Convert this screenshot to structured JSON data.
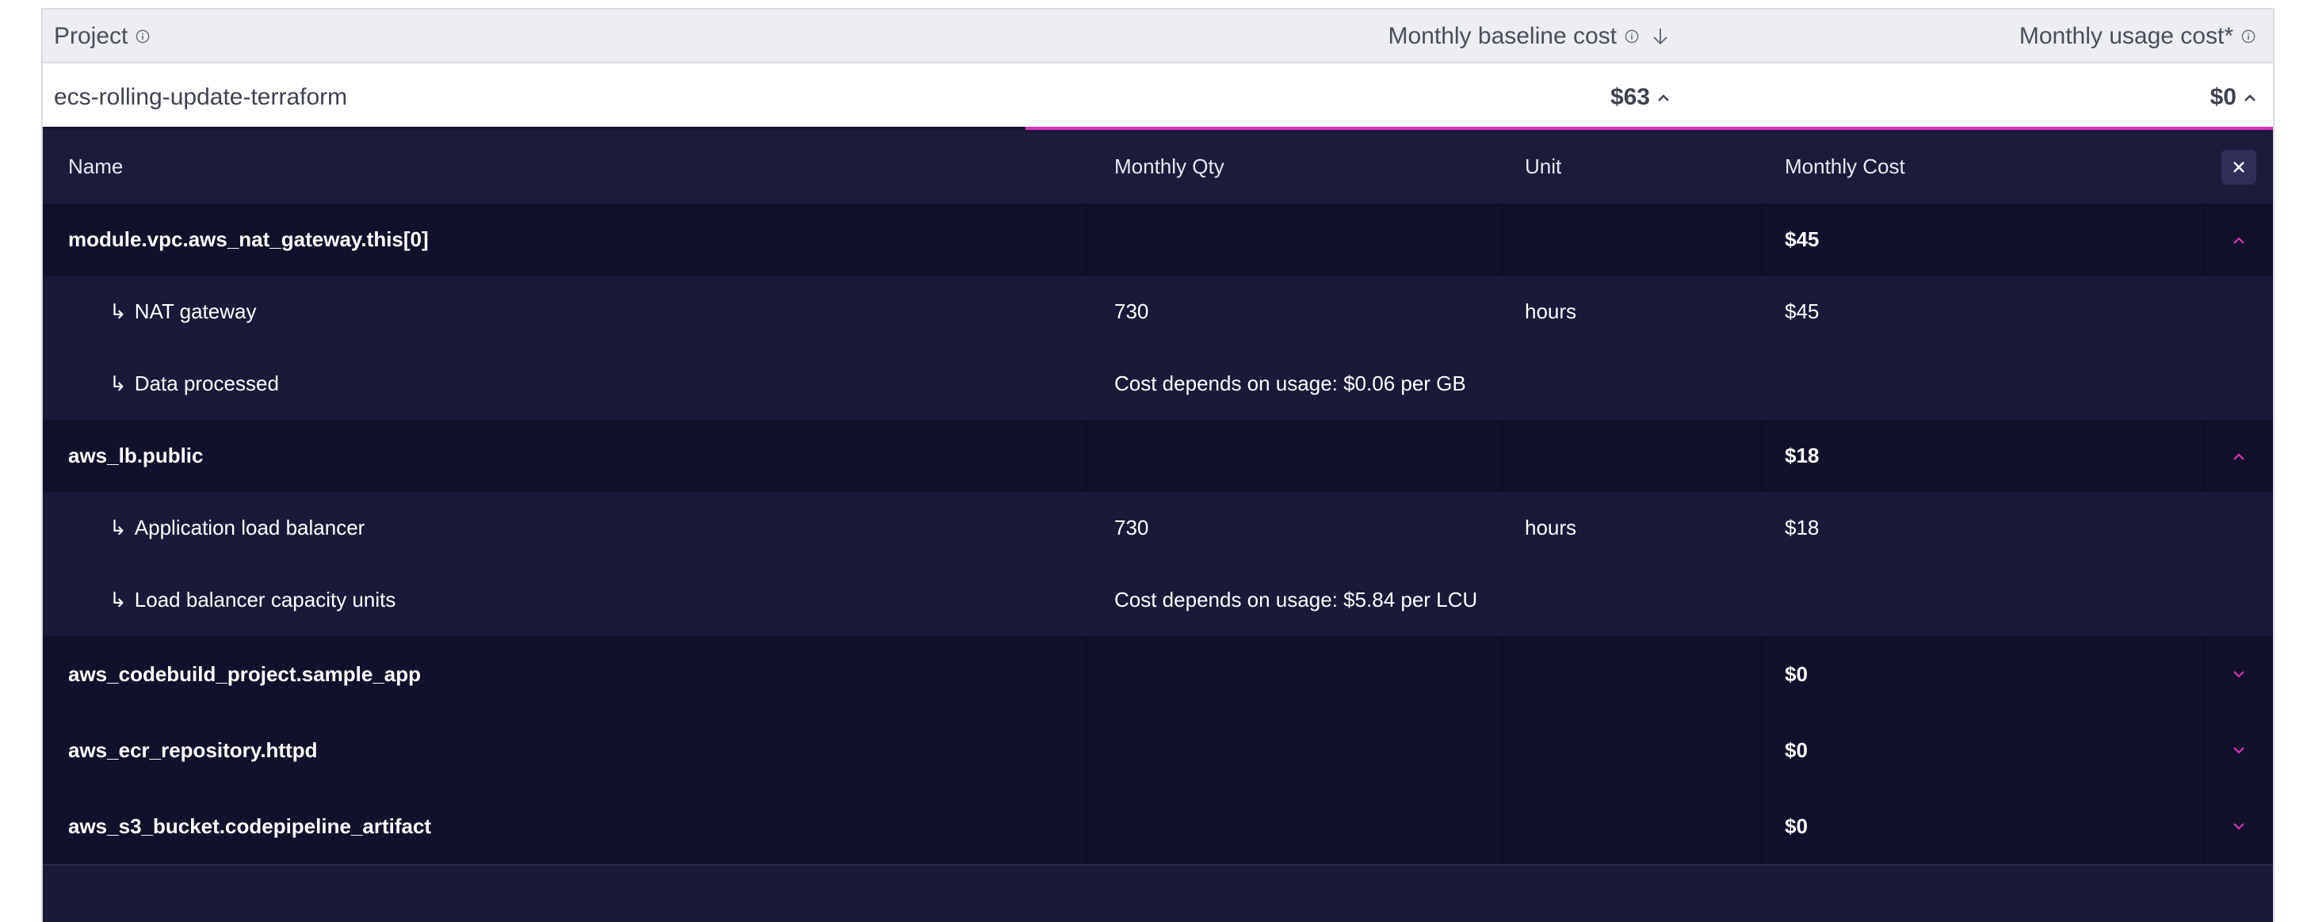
{
  "header": {
    "project_label": "Project",
    "baseline_label": "Monthly baseline cost",
    "usage_label": "Monthly usage cost*"
  },
  "project_row": {
    "name": "ecs-rolling-update-terraform",
    "baseline_cost": "$63",
    "usage_cost": "$0"
  },
  "table": {
    "columns": {
      "name": "Name",
      "qty": "Monthly Qty",
      "unit": "Unit",
      "cost": "Monthly Cost"
    },
    "rows": [
      {
        "name": "module.vpc.aws_nat_gateway.this[0]",
        "cost": "$45"
      },
      {
        "name": "NAT gateway",
        "qty": "730",
        "unit": "hours",
        "cost": "$45"
      },
      {
        "name": "Data processed",
        "qty": "Cost depends on usage: $0.06 per GB"
      },
      {
        "name": "aws_lb.public",
        "cost": "$18"
      },
      {
        "name": "Application load balancer",
        "qty": "730",
        "unit": "hours",
        "cost": "$18"
      },
      {
        "name": "Load balancer capacity units",
        "qty": "Cost depends on usage: $5.84 per LCU"
      },
      {
        "name": "aws_codebuild_project.sample_app",
        "cost": "$0"
      },
      {
        "name": "aws_ecr_repository.httpd",
        "cost": "$0"
      },
      {
        "name": "aws_s3_bucket.codepipeline_artifact",
        "cost": "$0"
      }
    ],
    "sub_prefix": "↳"
  },
  "colors": {
    "accent": "#d633b7",
    "panel": "#191939"
  }
}
